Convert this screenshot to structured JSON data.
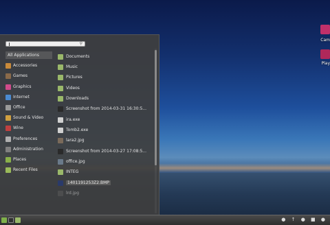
{
  "desktop": {
    "icons": [
      {
        "label": "Cam",
        "color": "#c0306a"
      },
      {
        "label": "Play",
        "color": "#b0285a"
      }
    ]
  },
  "menu": {
    "search": {
      "placeholder": ""
    },
    "categories": [
      {
        "label": "All Applications",
        "icon": "none",
        "color": ""
      },
      {
        "label": "Accessories",
        "icon": "accessories-icon",
        "color": "#c98a3a"
      },
      {
        "label": "Games",
        "icon": "games-icon",
        "color": "#8a6a4a"
      },
      {
        "label": "Graphics",
        "icon": "graphics-icon",
        "color": "#d04a8a"
      },
      {
        "label": "Internet",
        "icon": "internet-icon",
        "color": "#4a8ad0"
      },
      {
        "label": "Office",
        "icon": "office-icon",
        "color": "#9a9a9a"
      },
      {
        "label": "Sound & Video",
        "icon": "sound-video-icon",
        "color": "#d0a040"
      },
      {
        "label": "Wine",
        "icon": "wine-icon",
        "color": "#c04040"
      },
      {
        "label": "Preferences",
        "icon": "preferences-icon",
        "color": "#b0b0b0"
      },
      {
        "label": "Administration",
        "icon": "administration-icon",
        "color": "#808080"
      },
      {
        "label": "Places",
        "icon": "places-icon",
        "color": "#8ab04a"
      },
      {
        "label": "Recent Files",
        "icon": "recent-files-icon",
        "color": "#9aba5a"
      }
    ],
    "items": [
      {
        "label": "Documents",
        "icon": "folder-documents-icon",
        "color": "#9ab86a"
      },
      {
        "label": "Music",
        "icon": "folder-music-icon",
        "color": "#9ab86a"
      },
      {
        "label": "Pictures",
        "icon": "folder-pictures-icon",
        "color": "#9ab86a"
      },
      {
        "label": "Videos",
        "icon": "folder-videos-icon",
        "color": "#9ab86a"
      },
      {
        "label": "Downloads",
        "icon": "folder-downloads-icon",
        "color": "#9ab86a"
      },
      {
        "label": "Screenshot from 2014-03-31 16:30:5...",
        "icon": "image-icon",
        "color": "#2a2a2a"
      },
      {
        "label": "ira.exe",
        "icon": "exe-icon",
        "color": "#d0d0d0"
      },
      {
        "label": "Tomb2.exe",
        "icon": "exe-icon",
        "color": "#d0d0d0"
      },
      {
        "label": "lara2.jpg",
        "icon": "image-icon",
        "color": "#7a6a5a"
      },
      {
        "label": "Screenshot from 2014-03-27 17:08:5...",
        "icon": "image-icon",
        "color": "#2a2a2a"
      },
      {
        "label": "office.jpg",
        "icon": "image-icon",
        "color": "#6a7a8a"
      },
      {
        "label": "INTEG",
        "icon": "folder-icon",
        "color": "#9ab86a"
      },
      {
        "label": "1401191253Z2.BMP",
        "icon": "image-icon",
        "color": "#2a3a6a"
      },
      {
        "label": "lrd.jpg",
        "icon": "image-icon",
        "color": "#5a5a5a"
      }
    ]
  },
  "panel": {
    "launchers": [
      {
        "icon": "menu-icon",
        "color": "#7fb04a"
      },
      {
        "icon": "terminal-icon",
        "color": "#303030"
      },
      {
        "icon": "files-icon",
        "color": "#9ab86a"
      }
    ],
    "tray": "● ↑ ● ■ ●"
  }
}
